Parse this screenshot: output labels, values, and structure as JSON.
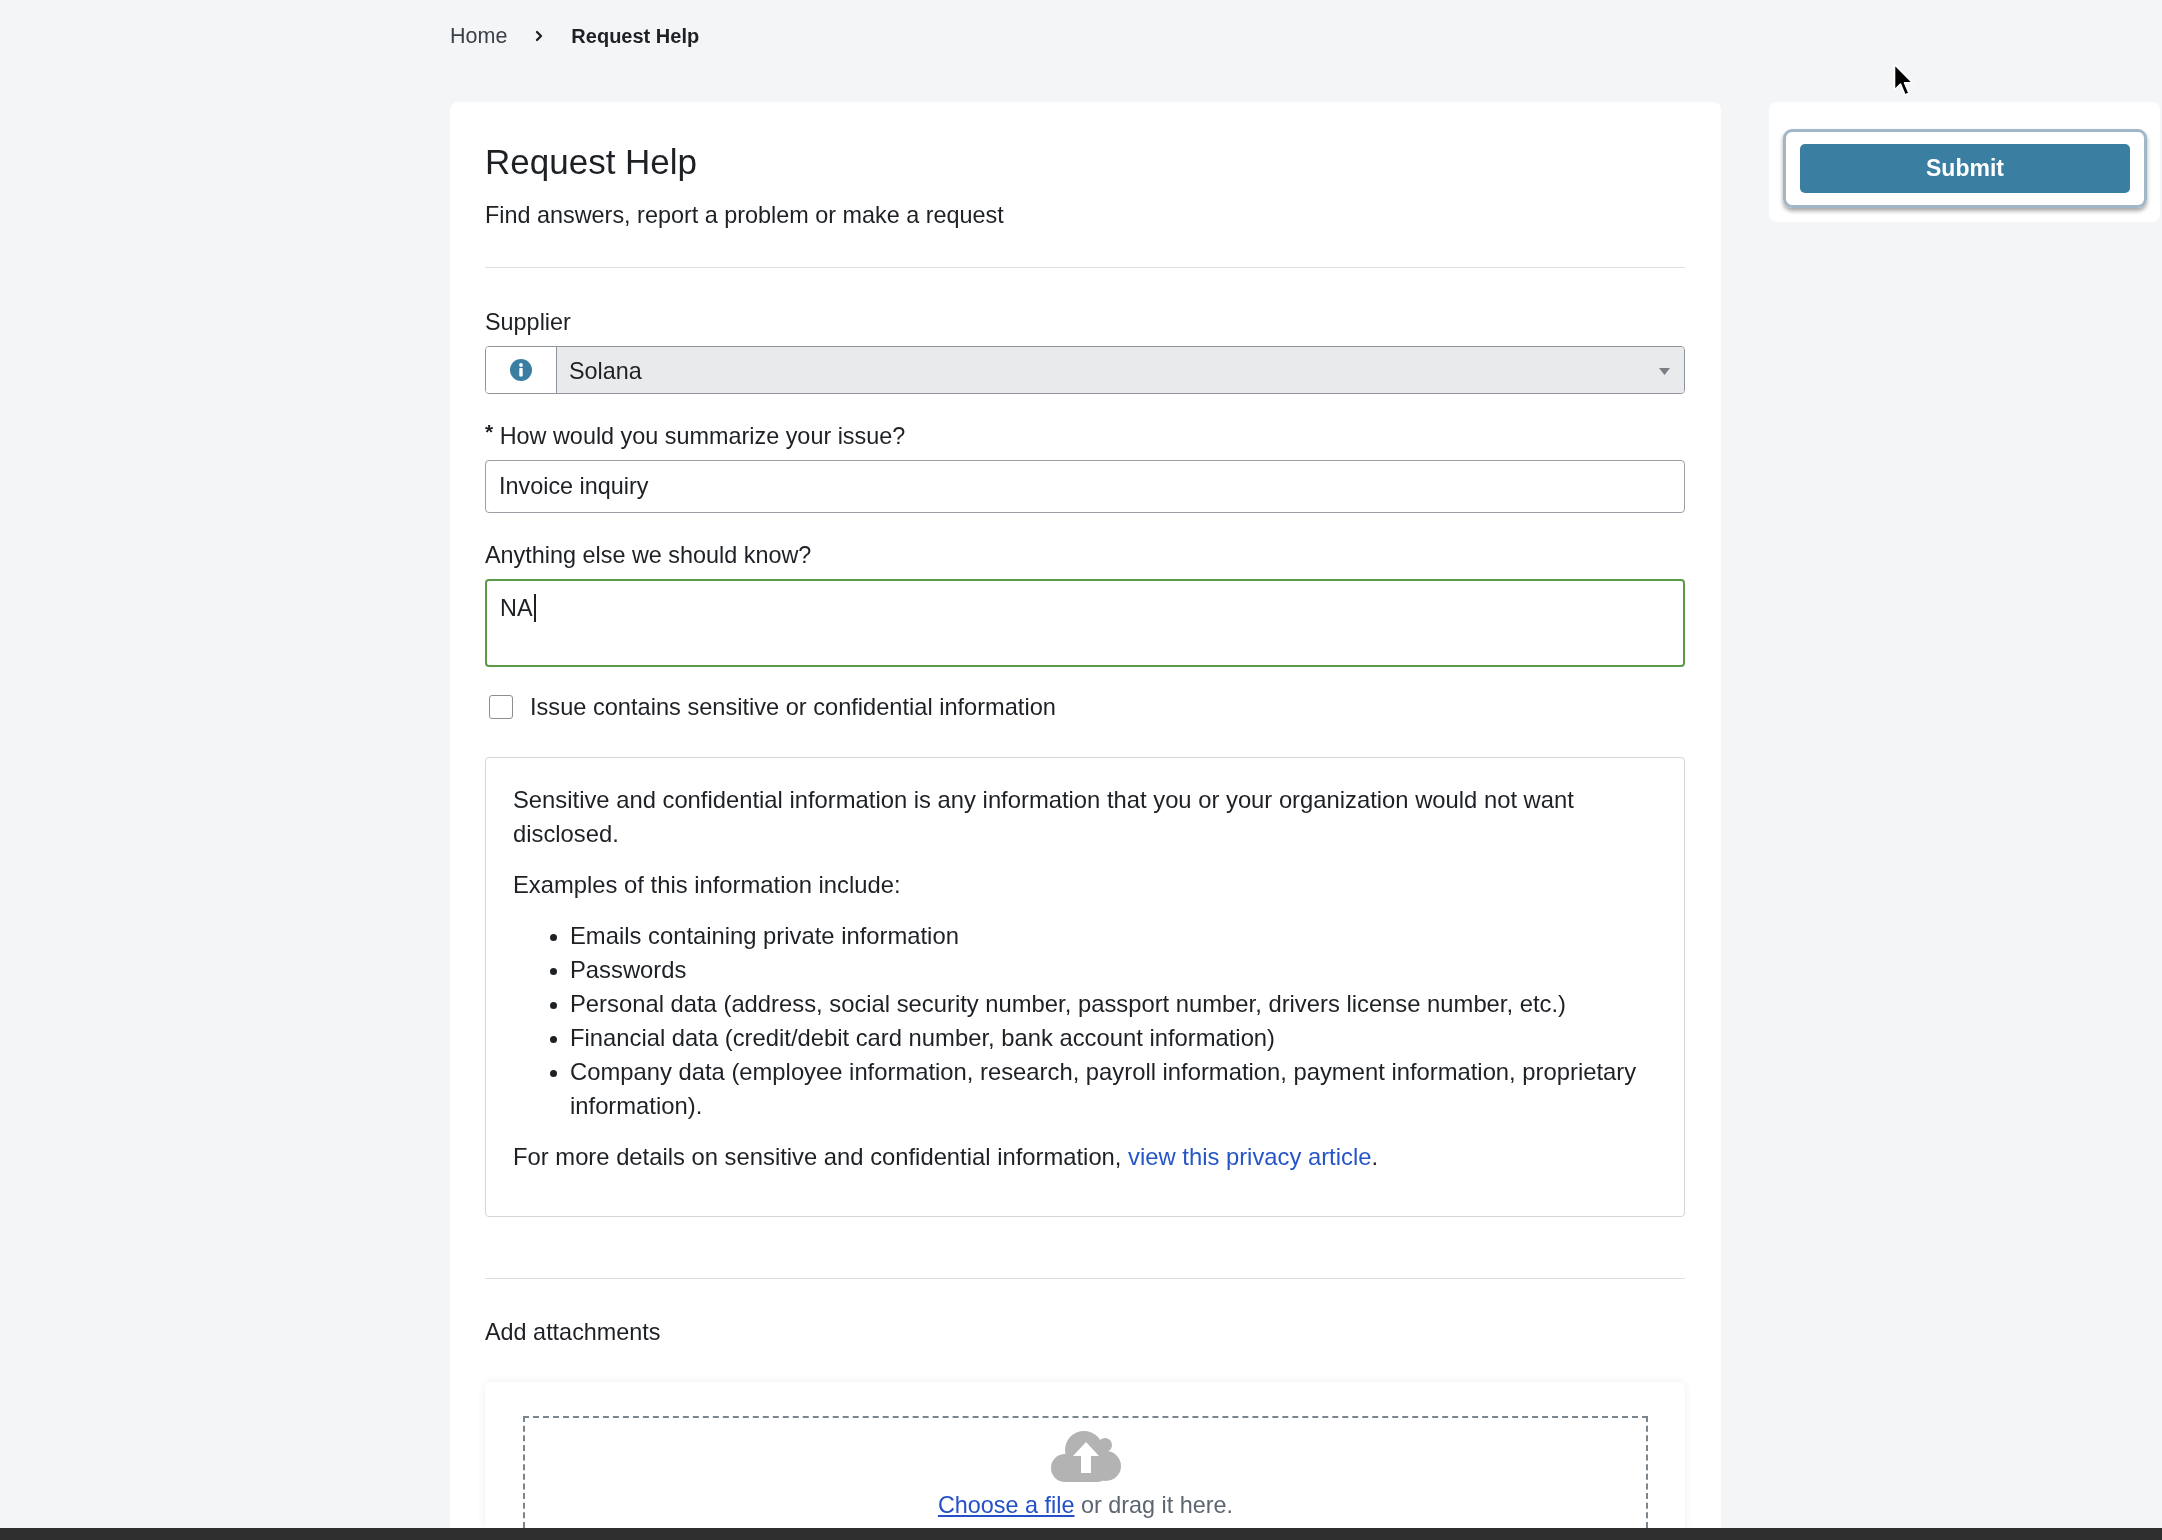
{
  "breadcrumb": [
    {
      "label": "Home",
      "current": false
    },
    {
      "label": "Request Help",
      "current": true
    }
  ],
  "page": {
    "title": "Request Help",
    "subtitle": "Find answers, report a problem or make a request"
  },
  "fields": [
    {
      "kind": "select",
      "label": "Supplier",
      "value": "Solana",
      "focused": false
    },
    {
      "kind": "text",
      "label": "How would you summarize your issue?",
      "required_mark": "*",
      "value": "Invoice inquiry",
      "focused": false
    },
    {
      "kind": "textarea",
      "label": "Anything else we should know?",
      "value": "NA",
      "focused": true
    }
  ],
  "sensitive_checkbox": {
    "label": "Issue contains sensitive or confidential information",
    "checked": false
  },
  "notice": {
    "intro": "Sensitive and confidential information is any information that you or your organization would not want disclosed.",
    "examples_heading": "Examples of this information include:",
    "examples": [
      "Emails containing private information",
      "Passwords",
      "Personal data (address, social security number, passport number, drivers license number, etc.)",
      "Financial data (credit/debit card number, bank account information)",
      "Company data (employee information, research, payroll information, payment information, proprietary information)."
    ],
    "more_text": "For more details on sensitive and confidential information,",
    "link": "view this privacy article",
    "end": "."
  },
  "attachments": {
    "title": "Add attachments",
    "choose_link": "Choose a file",
    "hint": "or drag it here."
  },
  "submit": {
    "label": "Submit",
    "focused": true
  }
}
